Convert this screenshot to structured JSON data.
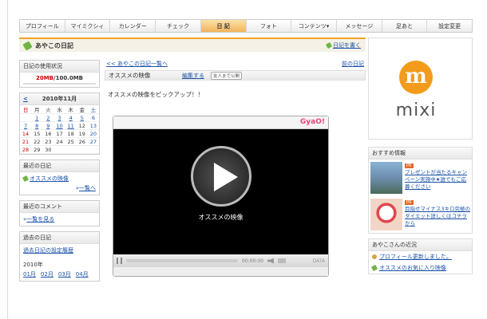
{
  "nav": {
    "items": [
      "プロフィール",
      "マイミクシィ",
      "カレンダー",
      "チェック",
      "日 記",
      "フォト",
      "コンテンツ▾",
      "メッセージ",
      "足あと",
      "設定変更"
    ],
    "active_index": 4
  },
  "diary": {
    "title": "あやこの日記",
    "write_link": "日記を書く"
  },
  "sidebar": {
    "usage": {
      "header": "日記の使用状況",
      "used": "20MB",
      "total": "/100.0MB"
    },
    "calendar": {
      "title": "2010年11月",
      "prev": "<",
      "weekdays": [
        "日",
        "月",
        "火",
        "水",
        "木",
        "金",
        "土"
      ],
      "weeks": [
        [
          "",
          "1",
          "2",
          "3",
          "4",
          "5",
          "6"
        ],
        [
          "7",
          "8",
          "9",
          "10",
          "11",
          "12",
          "13"
        ],
        [
          "14",
          "15",
          "16",
          "17",
          "18",
          "19",
          "20"
        ],
        [
          "21",
          "22",
          "23",
          "24",
          "25",
          "26",
          "27"
        ],
        [
          "28",
          "29",
          "30",
          "",
          "",
          "",
          ""
        ]
      ],
      "linked_days": [
        "1",
        "2",
        "3",
        "4",
        "5",
        "7",
        "8",
        "9",
        "10",
        "11"
      ]
    },
    "recent_diary": {
      "header": "最近の日記",
      "item": "オススメの映像",
      "more": "一覧へ"
    },
    "recent_comments": {
      "header": "最近のコメント",
      "link": "一覧を見る"
    },
    "past_diary": {
      "header": "過去の日記",
      "link": "過去日記の設定履歴",
      "year": "2010年",
      "months": [
        "01月",
        "02月",
        "03月",
        "04月"
      ]
    }
  },
  "main": {
    "back_link": "<< あやこの日記一覧へ",
    "prev_link": "前の日記",
    "entry_title": "オススメの映像",
    "edit_link": "編集する",
    "visibility_badge": "友人まで公開",
    "body_text": "オススメの映像をピックアップ！！",
    "player": {
      "logo": "GyaO!",
      "video_title": "オススメの映像",
      "time": "00:00:00",
      "data_label": "DATA"
    }
  },
  "right": {
    "logo_letter": "m",
    "logo_word": "mixi",
    "recommend": {
      "header": "おすすめ情報",
      "items": [
        {
          "tag": "PR",
          "text": "プレゼントが当たるキャンペーン実施中★誰でもご応募ください"
        },
        {
          "tag": "PR",
          "text": "目指せマイナス3キロ究極のダイエット詳しくはコチラから"
        }
      ]
    },
    "recent": {
      "header": "あやこさんの近況",
      "items": [
        "プロフィール更新しました。",
        "オススメのお気に入り映像"
      ]
    }
  }
}
